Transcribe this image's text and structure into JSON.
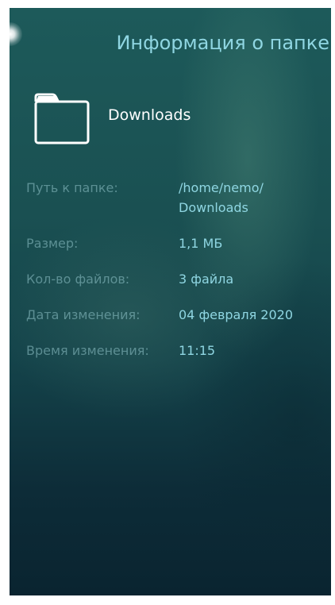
{
  "header": {
    "title": "Информация о папке"
  },
  "folder": {
    "name": "Downloads",
    "icon": "folder-icon"
  },
  "properties": [
    {
      "label": "Путь к папке:",
      "value": "/home/nemo/\nDownloads"
    },
    {
      "label": "Размер:",
      "value": "1,1 МБ"
    },
    {
      "label": "Кол-во файлов:",
      "value": "3 файла"
    },
    {
      "label": "Дата изменения:",
      "value": "04 февраля 2020"
    },
    {
      "label": "Время изменения:",
      "value": "11:15"
    }
  ],
  "colors": {
    "accent": "#8fd6e2",
    "background_top": "#1d5a5a",
    "background_bottom": "#0a2430"
  }
}
